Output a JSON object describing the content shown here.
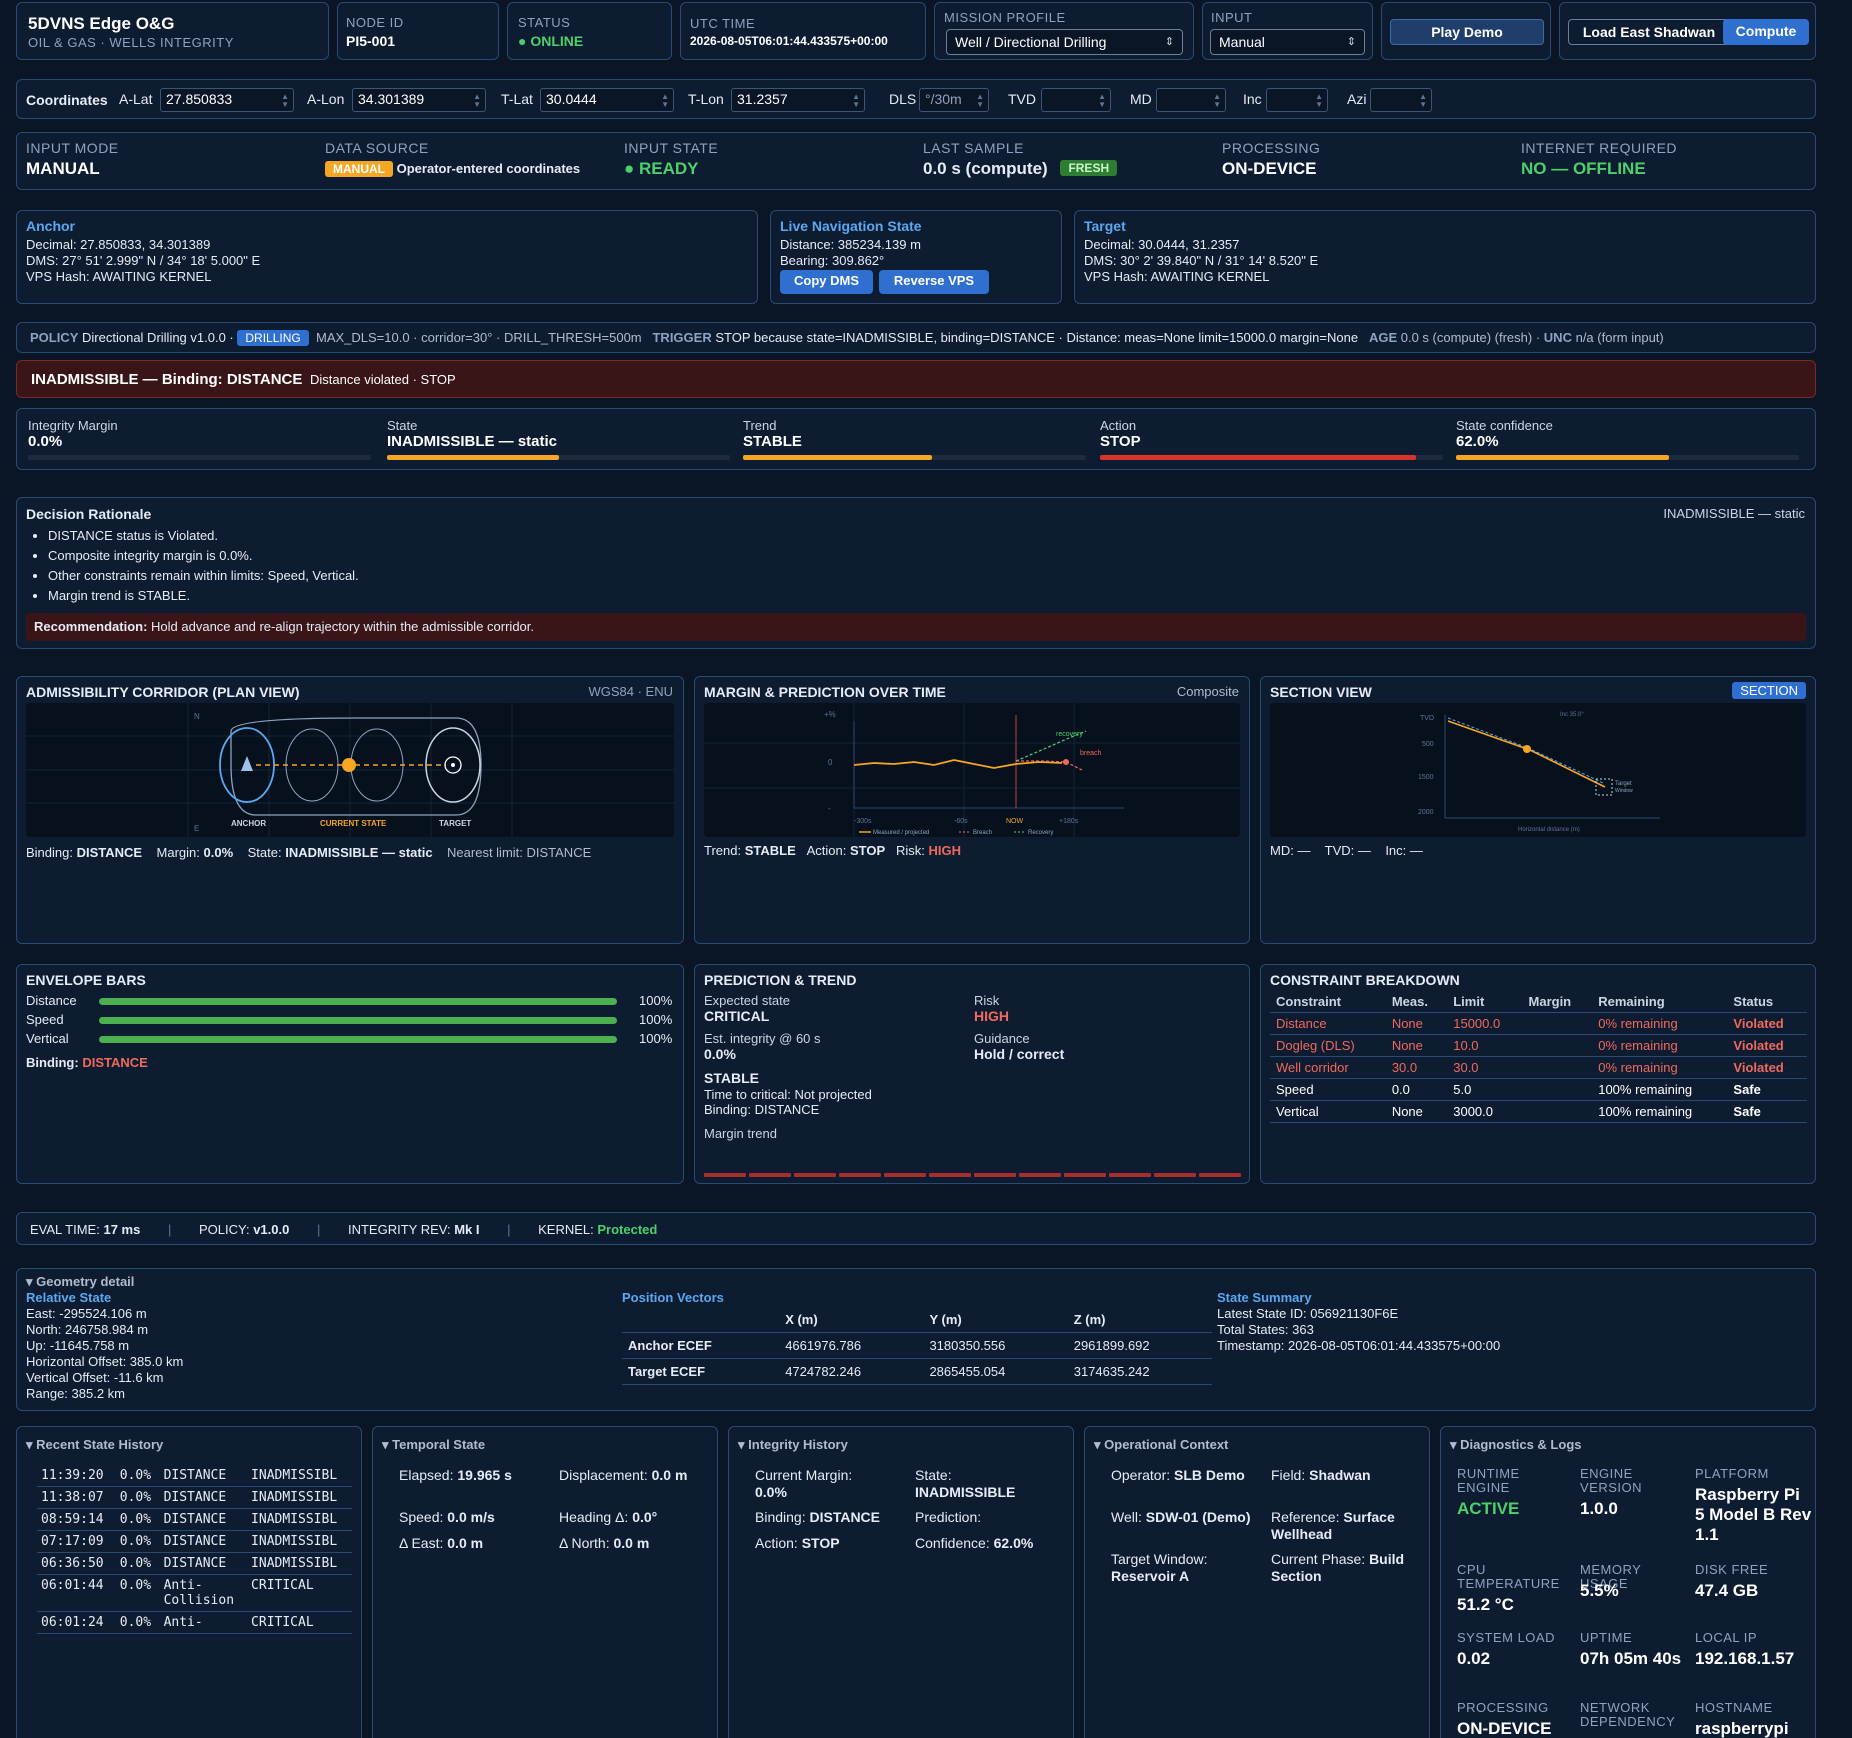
{
  "app": {
    "title": "5DVNS Edge O&G",
    "subtitle": "OIL & GAS · WELLS INTEGRITY"
  },
  "header": {
    "node_id_label": "NODE ID",
    "node_id": "PI5-001",
    "status_label": "STATUS",
    "status": "● ONLINE",
    "utc_label": "UTC TIME",
    "utc": "2026-08-05T06:01:44.433575+00:00",
    "mission_label": "MISSION PROFILE",
    "mission_value": "Well / Directional Drilling",
    "input_label": "INPUT",
    "input_value": "Manual",
    "play_demo": "Play Demo",
    "load_east": "Load East Shadwan",
    "compute": "Compute"
  },
  "coords": {
    "label": "Coordinates",
    "a_lat_label": "A-Lat",
    "a_lat": "27.850833",
    "a_lon_label": "A-Lon",
    "a_lon": "34.301389",
    "t_lat_label": "T-Lat",
    "t_lat": "30.0444",
    "t_lon_label": "T-Lon",
    "t_lon": "31.2357",
    "dls_label": "DLS",
    "dls_placeholder": "°/30m",
    "tvd_label": "TVD",
    "md_label": "MD",
    "inc_label": "Inc",
    "azi_label": "Azi"
  },
  "status_strip": {
    "input_mode_label": "INPUT MODE",
    "input_mode": "MANUAL",
    "data_source_label": "DATA SOURCE",
    "data_source_badge": "MANUAL",
    "data_source_text": "Operator-entered coordinates",
    "input_state_label": "INPUT STATE",
    "input_state": "● READY",
    "last_sample_label": "LAST SAMPLE",
    "last_sample": "0.0 s (compute)",
    "last_sample_badge": "FRESH",
    "processing_label": "PROCESSING",
    "processing": "ON-DEVICE",
    "internet_label": "INTERNET REQUIRED",
    "internet": "NO — OFFLINE"
  },
  "anchor": {
    "title": "Anchor",
    "decimal": "Decimal: 27.850833, 34.301389",
    "dms": "DMS: 27° 51' 2.999\" N / 34° 18' 5.000\" E",
    "vps": "VPS Hash: AWAITING KERNEL"
  },
  "live_nav": {
    "title": "Live Navigation State",
    "distance": "Distance: 385234.139 m",
    "bearing": "Bearing: 309.862°",
    "copy_dms": "Copy DMS",
    "reverse_vps": "Reverse VPS"
  },
  "target": {
    "title": "Target",
    "decimal": "Decimal: 30.0444, 31.2357",
    "dms": "DMS: 30° 2' 39.840\" N / 31° 14' 8.520\" E",
    "vps": "VPS Hash: AWAITING KERNEL"
  },
  "policy": {
    "label": "POLICY",
    "name": "Directional Drilling v1.0.0 ·",
    "badge": "DRILLING",
    "params": "MAX_DLS=10.0 · corridor=30° · DRILL_THRESH=500m",
    "trigger_label": "TRIGGER",
    "trigger": "STOP because state=INADMISSIBLE, binding=DISTANCE · Distance: meas=None limit=15000.0 margin=None",
    "age_label": "AGE",
    "age": "0.0 s (compute) (fresh) ·",
    "unc_label": "UNC",
    "unc": "n/a (form input)"
  },
  "alert": {
    "title": "INADMISSIBLE — Binding: DISTANCE",
    "detail": "Distance violated · STOP"
  },
  "metrics": [
    {
      "label": "Integrity Margin",
      "value": "0.0%",
      "fill": 0.0,
      "color": "#f5a623"
    },
    {
      "label": "State",
      "value": "INADMISSIBLE — static",
      "fill": 0.5,
      "color": "#f5a623"
    },
    {
      "label": "Trend",
      "value": "STABLE",
      "fill": 0.55,
      "color": "#f5a623"
    },
    {
      "label": "Action",
      "value": "STOP",
      "fill": 0.92,
      "color": "#d9342b"
    },
    {
      "label": "State confidence",
      "value": "62.0%",
      "fill": 0.62,
      "color": "#f5a623"
    }
  ],
  "rationale": {
    "title": "Decision Rationale",
    "state": "INADMISSIBLE — static",
    "bullets": [
      "DISTANCE status is Violated.",
      "Composite integrity margin is 0.0%.",
      "Other constraints remain within limits: Speed, Vertical.",
      "Margin trend is STABLE."
    ],
    "rec_label": "Recommendation:",
    "rec_text": "Hold advance and re-align trajectory within the admissible corridor."
  },
  "corridor": {
    "title": "ADMISSIBILITY CORRIDOR (PLAN VIEW)",
    "frame": "WGS84 · ENU",
    "n_label": "N",
    "e_label": "E",
    "anchor_label": "ANCHOR",
    "current_label": "CURRENT STATE",
    "target_label": "TARGET",
    "binding_label": "Binding:",
    "binding": "DISTANCE",
    "margin_label": "Margin:",
    "margin": "0.0%",
    "state_label": "State:",
    "state": "INADMISSIBLE — static",
    "nearest": "Nearest limit: DISTANCE"
  },
  "margin_chart": {
    "title": "MARGIN & PREDICTION OVER TIME",
    "tag": "Composite",
    "y_top": "+%",
    "y_mid": "0",
    "y_bot": "-",
    "x_ticks": [
      "-300s",
      "-60s",
      "NOW",
      "+180s"
    ],
    "recovery": "recovery",
    "breach": "breach",
    "legend": [
      "Measured / projected",
      "Breach",
      "Recovery"
    ],
    "trend_label": "Trend:",
    "trend": "STABLE",
    "action_label": "Action:",
    "action": "STOP",
    "risk_label": "Risk:",
    "risk": "HIGH"
  },
  "section_view": {
    "title": "SECTION VIEW",
    "badge": "SECTION",
    "y_ticks": [
      "TVD",
      "500",
      "1500",
      "2000"
    ],
    "inc": "Inc 35.0°",
    "target": "Target",
    "window": "Window",
    "x_label": "Horizontal distance (m)",
    "readout": "MD: —    TVD: —    Inc: —"
  },
  "envelope": {
    "title": "ENVELOPE BARS",
    "bars": [
      {
        "name": "Distance",
        "fill": 1.0,
        "value": "100%"
      },
      {
        "name": "Speed",
        "fill": 1.0,
        "value": "100%"
      },
      {
        "name": "Vertical",
        "fill": 1.0,
        "value": "100%"
      }
    ],
    "binding_label": "Binding:",
    "binding": "DISTANCE"
  },
  "prediction": {
    "title": "PREDICTION & TREND",
    "expected_label": "Expected state",
    "expected": "CRITICAL",
    "risk_label": "Risk",
    "risk": "HIGH",
    "est_label": "Est. integrity @ 60 s",
    "est": "0.0%",
    "guidance_label": "Guidance",
    "guidance": "Hold / correct",
    "trend": "STABLE",
    "ttc": "Time to critical: Not projected",
    "binding": "Binding: DISTANCE",
    "margin_trend": "Margin trend"
  },
  "constraints": {
    "title": "CONSTRAINT BREAKDOWN",
    "headers": [
      "Constraint",
      "Meas.",
      "Limit",
      "Margin",
      "Remaining",
      "Status"
    ],
    "rows": [
      {
        "c": "Distance",
        "m": "None",
        "l": "15000.0",
        "mg": "",
        "r": "0% remaining",
        "s": "Violated",
        "bad": true
      },
      {
        "c": "Dogleg (DLS)",
        "m": "None",
        "l": "10.0",
        "mg": "",
        "r": "0% remaining",
        "s": "Violated",
        "bad": true
      },
      {
        "c": "Well corridor",
        "m": "30.0",
        "l": "30.0",
        "mg": "",
        "r": "0% remaining",
        "s": "Violated",
        "bad": true
      },
      {
        "c": "Speed",
        "m": "0.0",
        "l": "5.0",
        "mg": "",
        "r": "100% remaining",
        "s": "Safe",
        "bad": false
      },
      {
        "c": "Vertical",
        "m": "None",
        "l": "3000.0",
        "mg": "",
        "r": "100% remaining",
        "s": "Safe",
        "bad": false
      }
    ]
  },
  "footer_bar": {
    "eval_label": "EVAL TIME:",
    "eval": "17 ms",
    "policy_label": "POLICY:",
    "policy": "v1.0.0",
    "rev_label": "INTEGRITY REV:",
    "rev": "Mk I",
    "kernel_label": "KERNEL:",
    "kernel": "Protected"
  },
  "geometry": {
    "title": "▾ Geometry detail",
    "relative_title": "Relative State",
    "relative": [
      "East: -295524.106 m",
      "North: 246758.984 m",
      "Up: -11645.758 m",
      "Horizontal Offset: 385.0 km",
      "Vertical Offset: -11.6 km",
      "Range: 385.2 km"
    ],
    "vectors_title": "Position Vectors",
    "vec_headers": [
      "",
      "X (m)",
      "Y (m)",
      "Z (m)"
    ],
    "vec_rows": [
      [
        "Anchor ECEF",
        "4661976.786",
        "3180350.556",
        "2961899.692"
      ],
      [
        "Target ECEF",
        "4724782.246",
        "2865455.054",
        "3174635.242"
      ]
    ],
    "summary_title": "State Summary",
    "summary": [
      "Latest State ID: 056921130F6E",
      "Total States: 363",
      "Timestamp: 2026-08-05T06:01:44.433575+00:00"
    ]
  },
  "history": {
    "title": "▾ Recent State History",
    "rows": [
      [
        "11:39:20",
        "0.0%",
        "DISTANCE",
        "INADMISSIBL"
      ],
      [
        "11:38:07",
        "0.0%",
        "DISTANCE",
        "INADMISSIBL"
      ],
      [
        "08:59:14",
        "0.0%",
        "DISTANCE",
        "INADMISSIBL"
      ],
      [
        "07:17:09",
        "0.0%",
        "DISTANCE",
        "INADMISSIBL"
      ],
      [
        "06:36:50",
        "0.0%",
        "DISTANCE",
        "INADMISSIBL"
      ],
      [
        "06:01:44",
        "0.0%",
        "Anti-\nCollision",
        "CRITICAL"
      ],
      [
        "06:01:24",
        "0.0%",
        "Anti-",
        "CRITICAL"
      ]
    ]
  },
  "temporal": {
    "title": "▾ Temporal State",
    "elapsed_label": "Elapsed:",
    "elapsed": "19.965 s",
    "disp_label": "Displacement:",
    "disp": "0.0 m",
    "speed_label": "Speed:",
    "speed": "0.0 m/s",
    "heading_label": "Heading Δ:",
    "heading": "0.0°",
    "de_label": "Δ East:",
    "de": "0.0 m",
    "dn_label": "Δ North:",
    "dn": "0.0 m"
  },
  "integrity": {
    "title": "▾ Integrity History",
    "margin_label": "Current Margin:",
    "margin": "0.0%",
    "state_label": "State:",
    "state": "INADMISSIBLE",
    "binding_label": "Binding:",
    "binding": "DISTANCE",
    "pred_label": "Prediction:",
    "pred": "",
    "action_label": "Action:",
    "action": "STOP",
    "conf_label": "Confidence:",
    "conf": "62.0%"
  },
  "opctx": {
    "title": "▾ Operational Context",
    "operator_label": "Operator:",
    "operator": "SLB Demo",
    "field_label": "Field:",
    "field": "Shadwan",
    "well_label": "Well:",
    "well": "SDW-01 (Demo)",
    "ref_label": "Reference:",
    "ref": "Surface Wellhead",
    "window_label": "Target Window:",
    "window": "Reservoir A",
    "phase_label": "Current Phase:",
    "phase": "Build Section"
  },
  "diag": {
    "title": "▾ Diagnostics & Logs",
    "items": [
      {
        "label": "RUNTIME ENGINE",
        "value": "ACTIVE",
        "green": true
      },
      {
        "label": "ENGINE VERSION",
        "value": "1.0.0",
        "green": false
      },
      {
        "label": "PLATFORM",
        "value": "Raspberry Pi 5 Model B Rev 1.1",
        "green": false
      },
      {
        "label": "CPU TEMPERATURE",
        "value": "51.2 °C",
        "green": false
      },
      {
        "label": "MEMORY USAGE",
        "value": "5.5%",
        "green": false
      },
      {
        "label": "DISK FREE",
        "value": "47.4 GB",
        "green": false
      },
      {
        "label": "SYSTEM LOAD",
        "value": "0.02",
        "green": false
      },
      {
        "label": "UPTIME",
        "value": "07h 05m 40s",
        "green": false
      },
      {
        "label": "LOCAL IP",
        "value": "192.168.1.57",
        "green": false
      },
      {
        "label": "PROCESSING",
        "value": "ON-DEVICE",
        "green": false
      },
      {
        "label": "NETWORK DEPENDENCY",
        "value": "",
        "green": false
      },
      {
        "label": "HOSTNAME",
        "value": "raspberrypi",
        "green": false
      }
    ]
  },
  "colors": {
    "accent": "#2f6fd0",
    "green": "#4cd16a",
    "red": "#ef6a5c",
    "orange": "#f5a623",
    "alert_bg": "#3a1518"
  }
}
